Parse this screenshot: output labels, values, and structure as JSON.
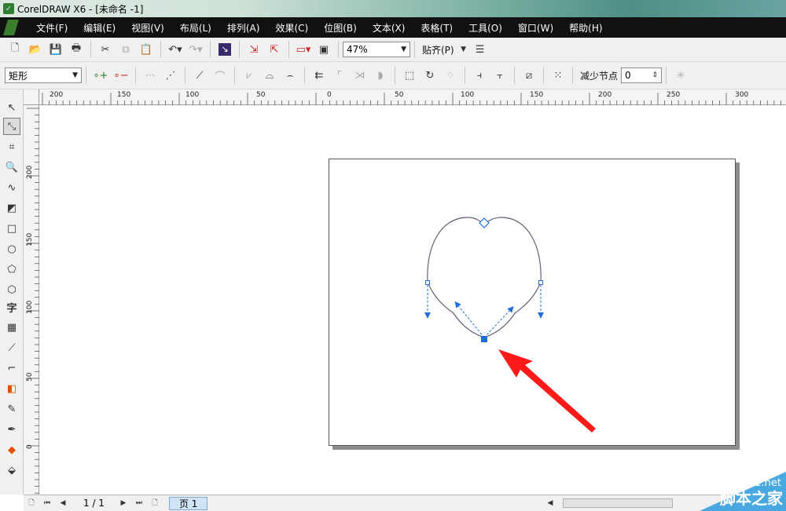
{
  "window": {
    "title": "CorelDRAW X6 - [未命名 -1]"
  },
  "menu": {
    "items": [
      "文件(F)",
      "编辑(E)",
      "视图(V)",
      "布局(L)",
      "排列(A)",
      "效果(C)",
      "位图(B)",
      "文本(X)",
      "表格(T)",
      "工具(O)",
      "窗口(W)",
      "帮助(H)"
    ]
  },
  "toolbar1": {
    "zoom_value": "47%",
    "snap_label": "贴齐(P)"
  },
  "toolbar2": {
    "shape_select": "矩形",
    "reduce_nodes_label": "减少节点",
    "reduce_nodes_value": "0"
  },
  "rulers": {
    "horizontal_labels": [
      "200",
      "150",
      "100",
      "50",
      "0",
      "50",
      "100",
      "150",
      "200",
      "250",
      "300"
    ],
    "vertical_labels": [
      "200",
      "150",
      "100",
      "50",
      "0"
    ]
  },
  "status": {
    "page_count": "1 / 1",
    "page_tab": "页 1"
  },
  "watermark": {
    "site": "jb51.net",
    "name": "脚本之家"
  },
  "colors": {
    "node_selected": "#1f6fd6",
    "arrow": "#ff1a1a",
    "curve": "#6a5a78"
  }
}
